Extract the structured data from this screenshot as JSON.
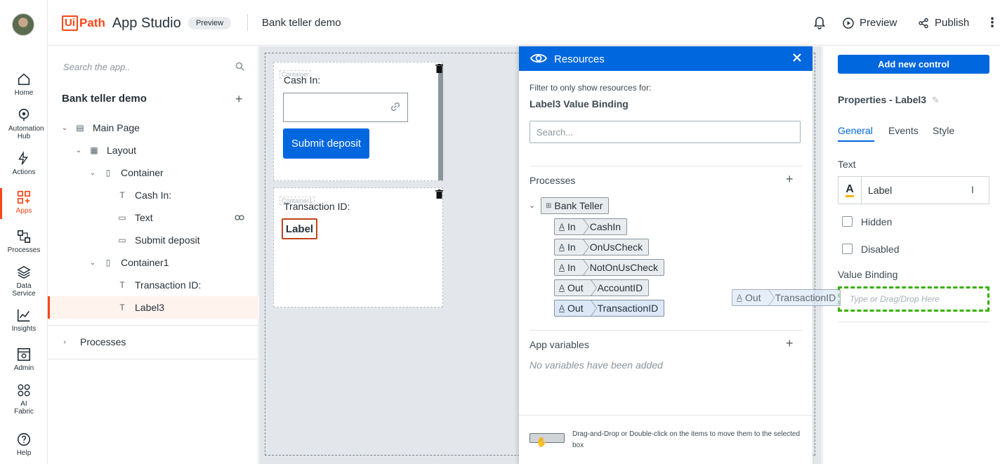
{
  "nav": {
    "items": [
      {
        "label": "Home",
        "icon": "home-icon"
      },
      {
        "label": "Automation Hub",
        "icon": "automation-hub-icon"
      },
      {
        "label": "Actions",
        "icon": "actions-icon"
      },
      {
        "label": "Apps",
        "icon": "apps-icon",
        "active": true
      },
      {
        "label": "Processes",
        "icon": "processes-icon"
      },
      {
        "label": "Data Service",
        "icon": "data-service-icon"
      },
      {
        "label": "Insights",
        "icon": "insights-icon"
      },
      {
        "label": "Admin",
        "icon": "admin-icon"
      },
      {
        "label": "AI Fabric",
        "icon": "ai-fabric-icon"
      },
      {
        "label": "Help",
        "icon": "help-icon"
      }
    ]
  },
  "header": {
    "logo_ui": "Ui",
    "logo_path": "Path",
    "product": "App Studio",
    "badge": "Preview",
    "app_name": "Bank teller demo",
    "preview_label": "Preview",
    "publish_label": "Publish",
    "accent": "#fa4616"
  },
  "tree": {
    "search_placeholder": "Search the app..",
    "app_title": "Bank teller demo",
    "nodes": [
      "Main Page",
      "Layout",
      "Container",
      "Cash In:",
      "Text",
      "Submit deposit",
      "Container1",
      "Transaction ID:",
      "Label3"
    ],
    "processes": "Processes"
  },
  "canvas": {
    "container_tag": "Container",
    "container1_tag": "Container1",
    "cash_in_label": "Cash In:",
    "submit_label": "Submit deposit",
    "transaction_label": "Transaction ID:",
    "label_text": "Label"
  },
  "resources": {
    "title": "Resources",
    "filter_text": "Filter to only show resources for:",
    "filter_target": "Label3 Value Binding",
    "search_placeholder": "Search...",
    "processes_heading": "Processes",
    "process_name": "Bank Teller",
    "args": [
      {
        "dir": "In",
        "name": "CashIn"
      },
      {
        "dir": "In",
        "name": "OnUsCheck"
      },
      {
        "dir": "In",
        "name": "NotOnUsCheck"
      },
      {
        "dir": "Out",
        "name": "AccountID"
      },
      {
        "dir": "Out",
        "name": "TransactionID"
      }
    ],
    "app_vars_heading": "App variables",
    "no_vars": "No variables have been added",
    "footer_hint": "Drag-and-Drop or Double-click on the items to move them to the selected box",
    "drag_ghost": {
      "dir": "Out",
      "name": "TransactionID"
    }
  },
  "properties": {
    "add_control": "Add new control",
    "title": "Properties - Label3",
    "tabs": [
      "General",
      "Events",
      "Style"
    ],
    "text_label": "Text",
    "text_value": "Label",
    "hidden_label": "Hidden",
    "disabled_label": "Disabled",
    "value_binding_label": "Value Binding",
    "value_binding_placeholder": "Type or Drag/Drop Here",
    "drop_color": "#38b000"
  }
}
